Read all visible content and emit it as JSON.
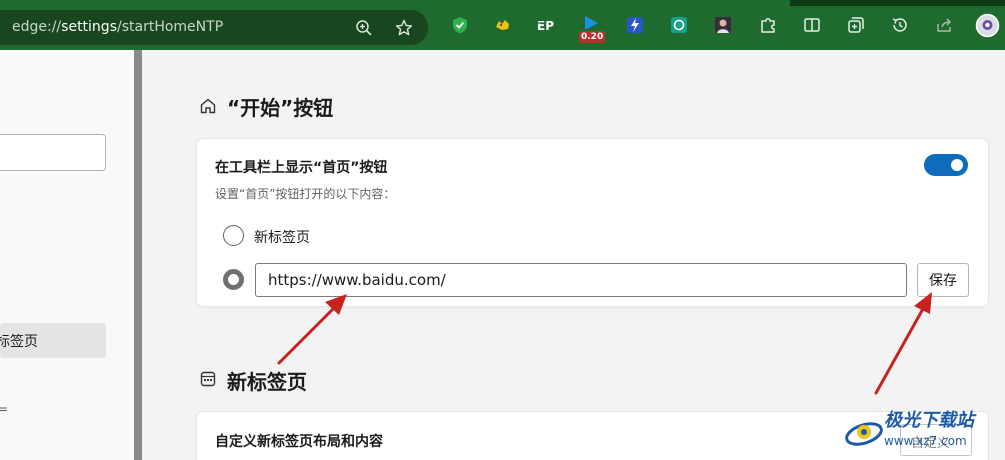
{
  "browser": {
    "address_scheme": "edge://",
    "address_host": "settings",
    "address_path": "/startHomeNTP",
    "extension_badge": "0.20"
  },
  "icons": {
    "address": [
      "zoom-icon",
      "favorite-star-icon"
    ],
    "extensions": [
      "shield-check-icon",
      "extension-cat-icon",
      "extension-ep-icon",
      "extension-play-icon",
      "extension-lightning-icon",
      "extension-ai-icon",
      "extension-avatar-icon"
    ],
    "browser": [
      "puzzle-icon",
      "split-screen-icon",
      "collections-icon",
      "history-icon",
      "share-icon",
      "profile-icon"
    ]
  },
  "leftnav": {
    "active_item": "标签页",
    "mark": "="
  },
  "start_section": {
    "title": "“开始”按钮",
    "card": {
      "title": "在工具栏上显示“首页”按钮",
      "subtitle": "设置“首页”按钮打开的以下内容：",
      "toggle_on": true,
      "option_new_tab": "新标签页",
      "url_value": "https://www.baidu.com/",
      "save_label": "保存"
    }
  },
  "newtab_section": {
    "title": "新标签页",
    "card": {
      "title": "自定义新标签页布局和内容",
      "button_label": "自定义"
    }
  },
  "watermark": {
    "brand": "极光下载站",
    "domain": "www.xz7.com"
  },
  "colors": {
    "toolbar": "#1f6a2e",
    "toggle_accent": "#0f6cbd",
    "arrow": "#c9221e"
  }
}
